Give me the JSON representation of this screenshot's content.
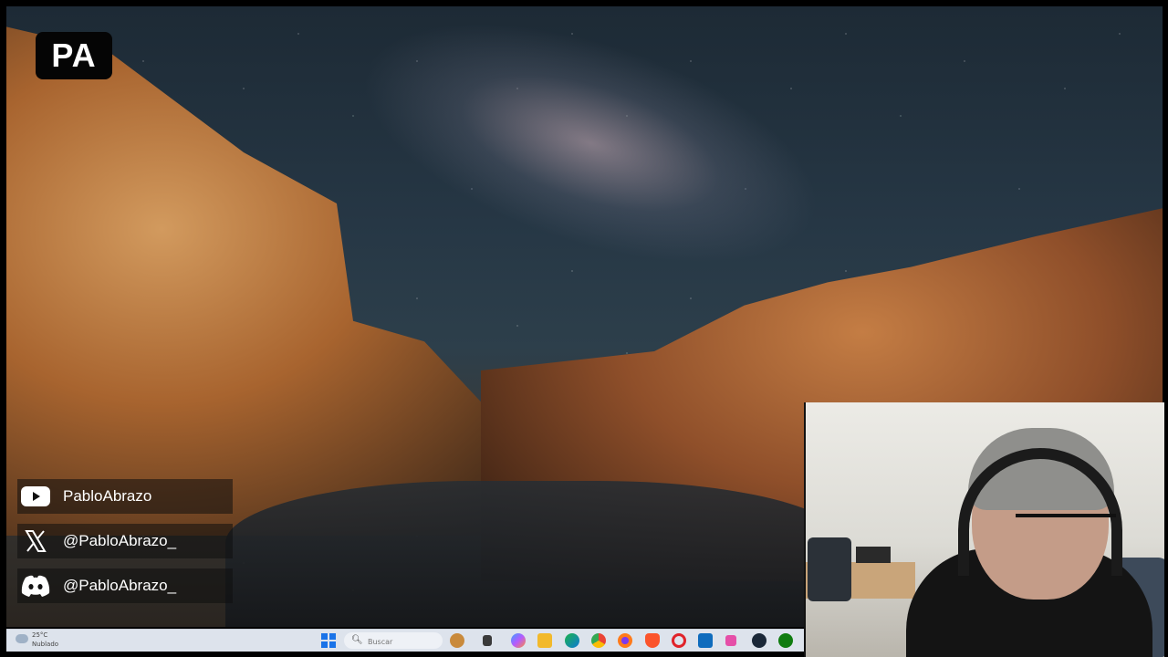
{
  "logo": {
    "text": "PA"
  },
  "socials": [
    {
      "icon": "youtube-icon",
      "handle": "PabloAbrazo"
    },
    {
      "icon": "x-icon",
      "handle": "@PabloAbrazo_"
    },
    {
      "icon": "discord-icon",
      "handle": "@PabloAbrazo_"
    }
  ],
  "taskbar": {
    "weather": {
      "temperature": "25°C",
      "condition": "Nublado"
    },
    "search": {
      "placeholder": "Buscar"
    },
    "apps": [
      "start-icon",
      "widgets-icon",
      "task-view-icon",
      "copilot-icon",
      "file-explorer-icon",
      "edge-icon",
      "chrome-icon",
      "firefox-icon",
      "brave-icon",
      "opera-icon",
      "outlook-icon",
      "snipping-tool-icon",
      "steam-icon",
      "xbox-icon"
    ]
  },
  "colors": {
    "taskbar": "#dde3ec",
    "social_card": "#0f0f0f",
    "youtube": "#ffffff",
    "accent": "#1a73e8"
  }
}
